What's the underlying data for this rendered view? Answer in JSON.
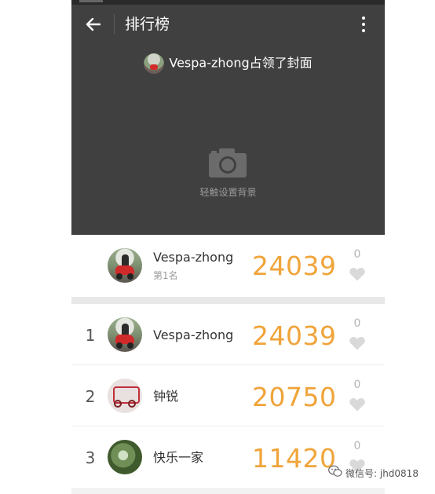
{
  "toolbar": {
    "title": "排行榜"
  },
  "cover": {
    "owner_text": "Vespa-zhong占领了封面",
    "hint": "轻触设置背景"
  },
  "my_entry": {
    "name": "Vespa-zhong",
    "rank_text": "第1名",
    "steps": "24039",
    "likes": "0"
  },
  "leaderboard": [
    {
      "rank": "1",
      "name": "Vespa-zhong",
      "steps": "24039",
      "likes": "0"
    },
    {
      "rank": "2",
      "name": "钟锐",
      "steps": "20750",
      "likes": "0"
    },
    {
      "rank": "3",
      "name": "快乐一家",
      "steps": "11420",
      "likes": "0"
    }
  ],
  "watermark": {
    "text": "微信号: jhd0818"
  },
  "colors": {
    "header_bg": "#404040",
    "steps": "#f0a43a",
    "heart": "#d9d9d9"
  },
  "icons": [
    "back-arrow-icon",
    "more-vert-icon",
    "camera-icon",
    "heart-icon",
    "wechat-icon"
  ]
}
